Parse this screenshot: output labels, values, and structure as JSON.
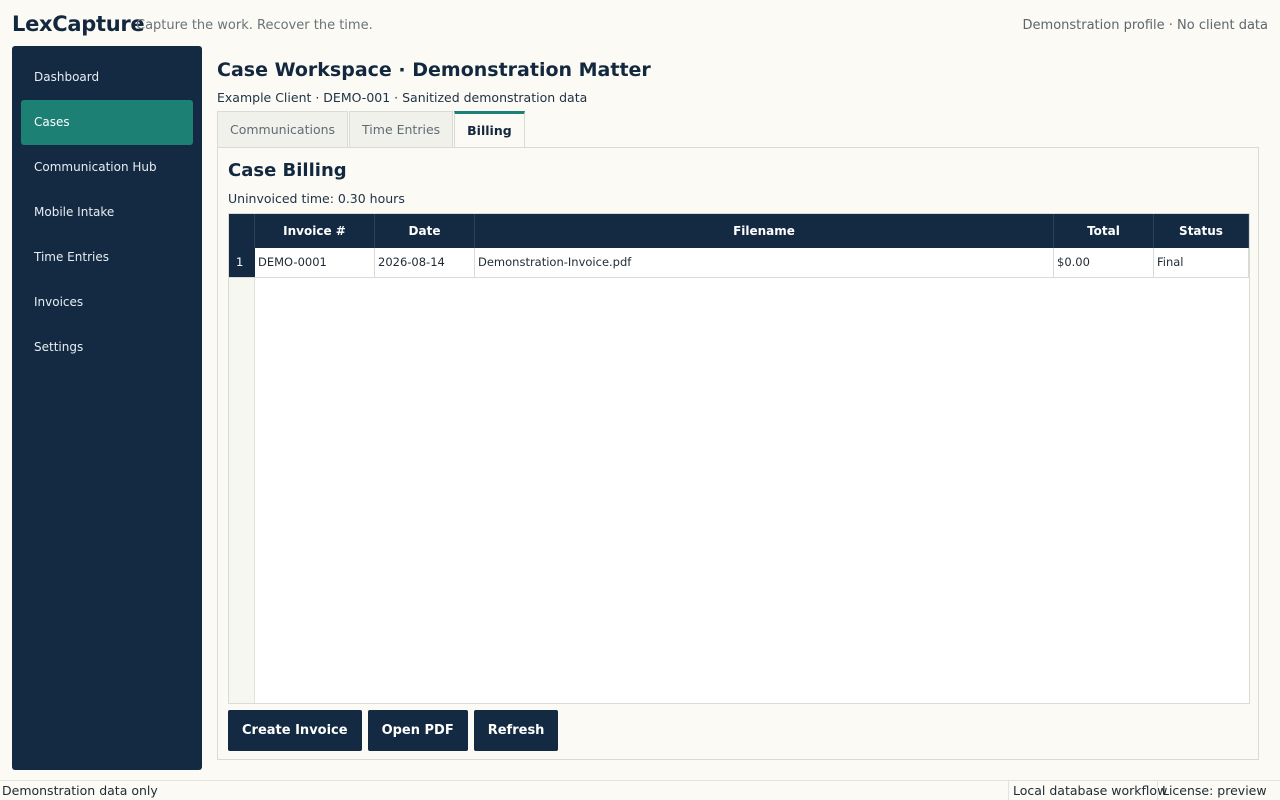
{
  "header": {
    "brand": "LexCapture",
    "tagline": "Capture the work. Recover the time.",
    "profile": "Demonstration profile · No client data"
  },
  "sidebar": {
    "items": [
      {
        "label": "Dashboard",
        "active": false
      },
      {
        "label": "Cases",
        "active": true
      },
      {
        "label": "Communication Hub",
        "active": false
      },
      {
        "label": "Mobile Intake",
        "active": false
      },
      {
        "label": "Time Entries",
        "active": false
      },
      {
        "label": "Invoices",
        "active": false
      },
      {
        "label": "Settings",
        "active": false
      }
    ]
  },
  "main": {
    "title": "Case Workspace · Demonstration Matter",
    "subtitle": "Example Client · DEMO-001 · Sanitized demonstration data",
    "tabs": [
      {
        "label": "Communications",
        "active": false
      },
      {
        "label": "Time Entries",
        "active": false
      },
      {
        "label": "Billing",
        "active": true
      }
    ]
  },
  "billing": {
    "title": "Case Billing",
    "uninvoiced": "Uninvoiced time: 0.30 hours",
    "columns": [
      "Invoice #",
      "Date",
      "Filename",
      "Total",
      "Status"
    ],
    "rows": [
      {
        "num": "1",
        "invoice": "DEMO-0001",
        "date": "2026-08-14",
        "filename": "Demonstration-Invoice.pdf",
        "total": "$0.00",
        "status": "Final"
      }
    ],
    "buttons": {
      "create": "Create Invoice",
      "open_pdf": "Open PDF",
      "refresh": "Refresh"
    }
  },
  "statusbar": {
    "left": "Demonstration data only",
    "db": "Local database workflow",
    "license": "License: preview"
  },
  "colors": {
    "navy": "#132a42",
    "teal": "#1c8075",
    "background": "#fbfaf4"
  }
}
